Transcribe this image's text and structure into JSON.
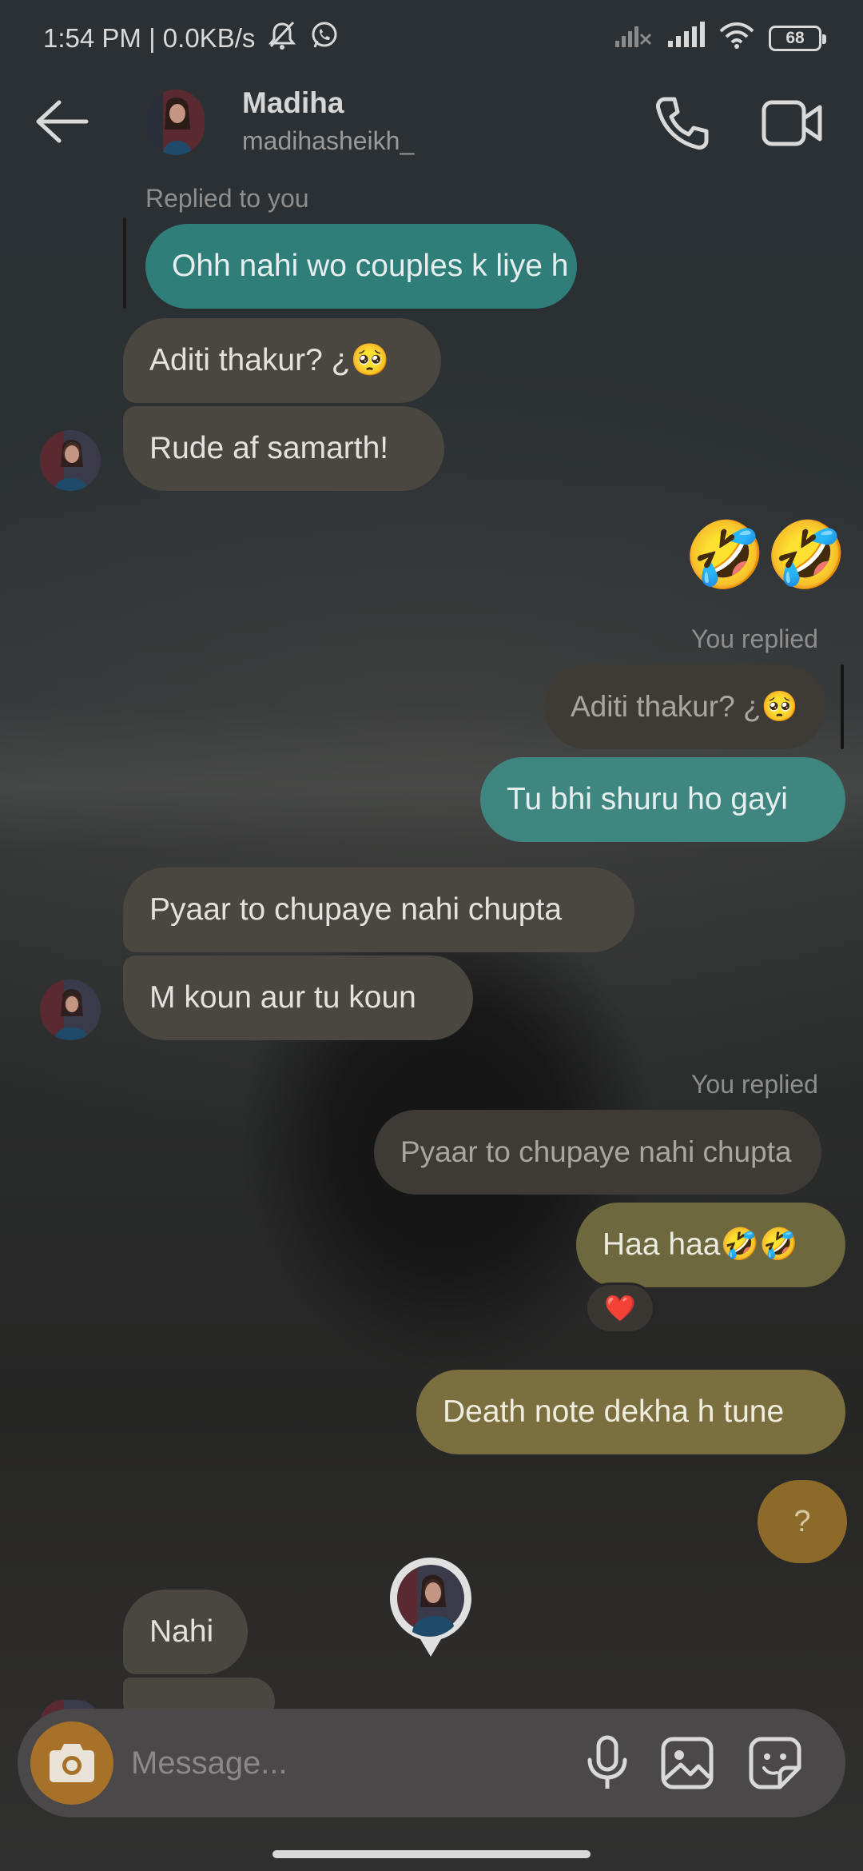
{
  "status_bar": {
    "time_speed": "1:54 PM | 0.0KB/s",
    "battery": "68"
  },
  "header": {
    "name": "Madiha",
    "username": "madihasheikh_"
  },
  "messages": {
    "replied_to_you": "Replied to you",
    "m1": "Ohh nahi wo couples k liye h",
    "m2": "Aditi thakur? ¿🥺",
    "m3": "Rude af samarth!",
    "m4_emoji": "🤣🤣",
    "you_replied_1": "You replied",
    "q1": "Aditi thakur? ¿🥺",
    "m5": "Tu bhi shuru ho gayi",
    "m6": "Pyaar to chupaye nahi chupta",
    "m7": "M koun aur tu koun",
    "you_replied_2": "You replied",
    "q2": "Pyaar to chupaye nahi chupta",
    "m8": "Haa haa🤣🤣",
    "reaction": "❤️",
    "m9": "Death note dekha h tune",
    "help": "?",
    "m10": "Nahi"
  },
  "composer": {
    "placeholder": "Message..."
  },
  "colors": {
    "teal_bubble": "#2f7e7a",
    "olive_bubble": "#6e683f",
    "incoming_bubble": "#4a4640",
    "camera_button": "#a8712a"
  }
}
